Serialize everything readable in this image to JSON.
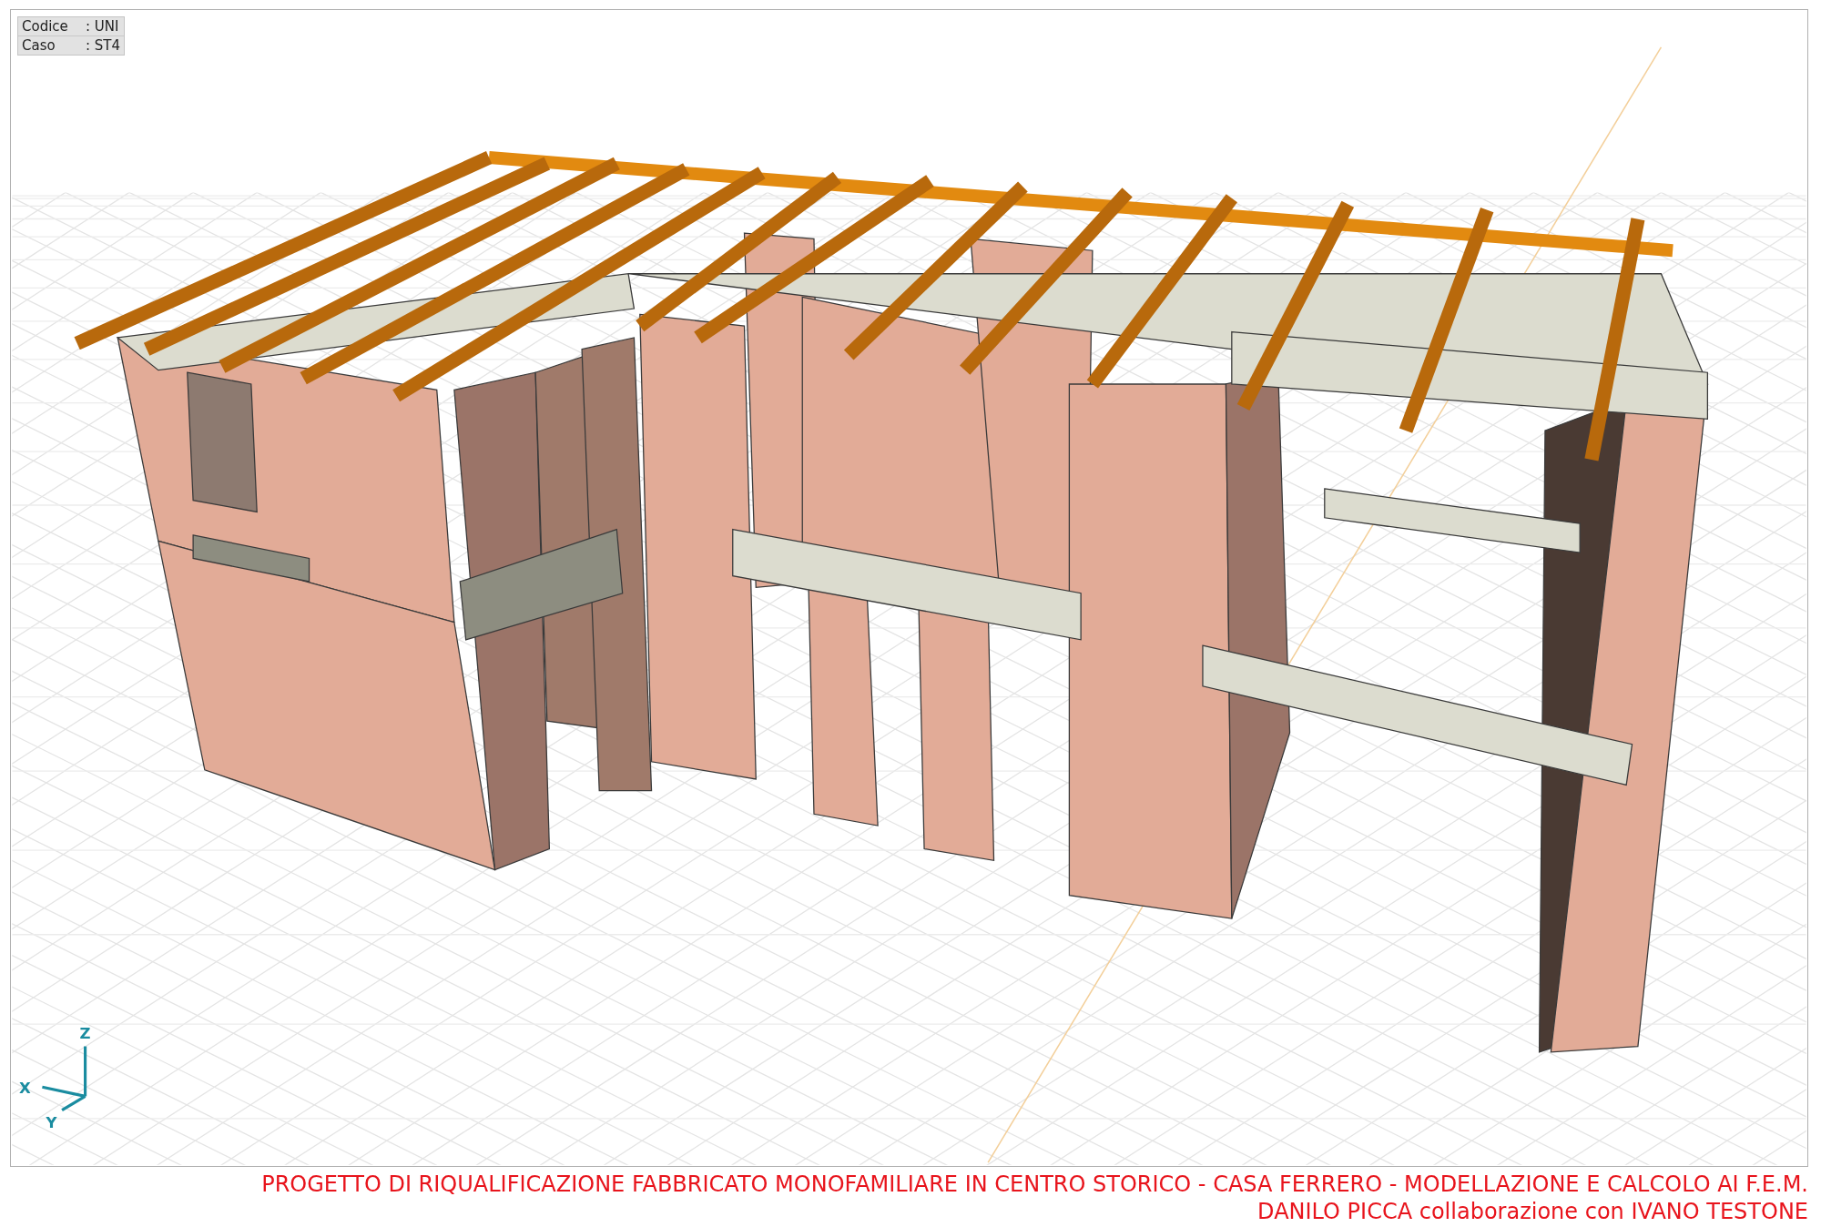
{
  "viewport": {
    "info": [
      {
        "label": "Codice",
        "value": ": UNI"
      },
      {
        "label": "Caso",
        "value": ": ST4"
      }
    ],
    "axes": {
      "x": "X",
      "y": "Y",
      "z": "Z"
    }
  },
  "footer": {
    "lines": [
      "PROGETTO DI RIQUALIFICAZIONE FABBRICATO MONOFAMILIARE IN CENTRO STORICO - CASA FERRERO - MODELLAZIONE E CALCOLO AI F.E.M.",
      "DANILO PICCA collaborazione con IVANO TESTONE"
    ]
  }
}
